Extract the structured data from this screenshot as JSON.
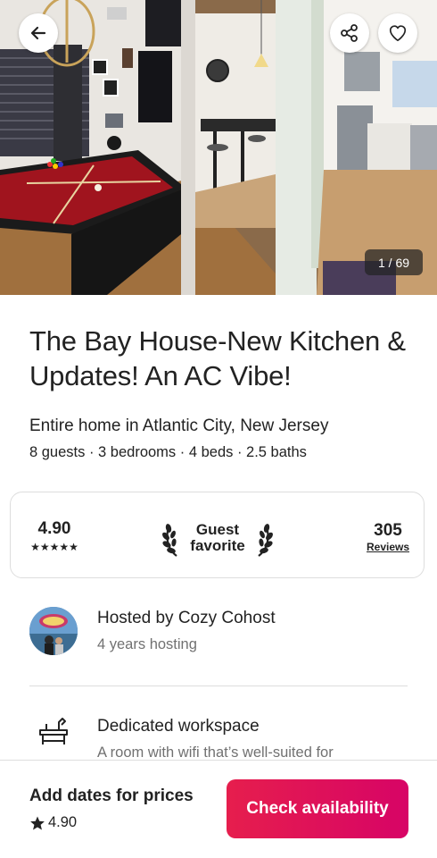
{
  "hero": {
    "photo_counter": "1 / 69"
  },
  "listing": {
    "title": "The Bay House-New Kitchen & Updates! An AC Vibe!",
    "subtitle": "Entire home in Atlantic City, New Jersey",
    "specs": "8 guests · 3 bedrooms · 4 beds · 2.5 baths"
  },
  "rating_card": {
    "rating": "4.90",
    "stars": "★★★★★",
    "badge_line1": "Guest",
    "badge_line2": "favorite",
    "reviews_count": "305",
    "reviews_label": "Reviews"
  },
  "host": {
    "name": "Hosted by Cozy Cohost",
    "years": "4 years hosting"
  },
  "amenity": {
    "icon": "desk-workspace-icon",
    "title": "Dedicated workspace",
    "description": "A room with wifi that’s well-suited for"
  },
  "footer": {
    "price_prompt": "Add dates for prices",
    "rating": "4.90",
    "cta_label": "Check availability"
  },
  "colors": {
    "cta_start": "#e61e4d",
    "cta_end": "#d70466",
    "text_primary": "#222222",
    "text_secondary": "#717171",
    "divider": "#dddddd"
  }
}
